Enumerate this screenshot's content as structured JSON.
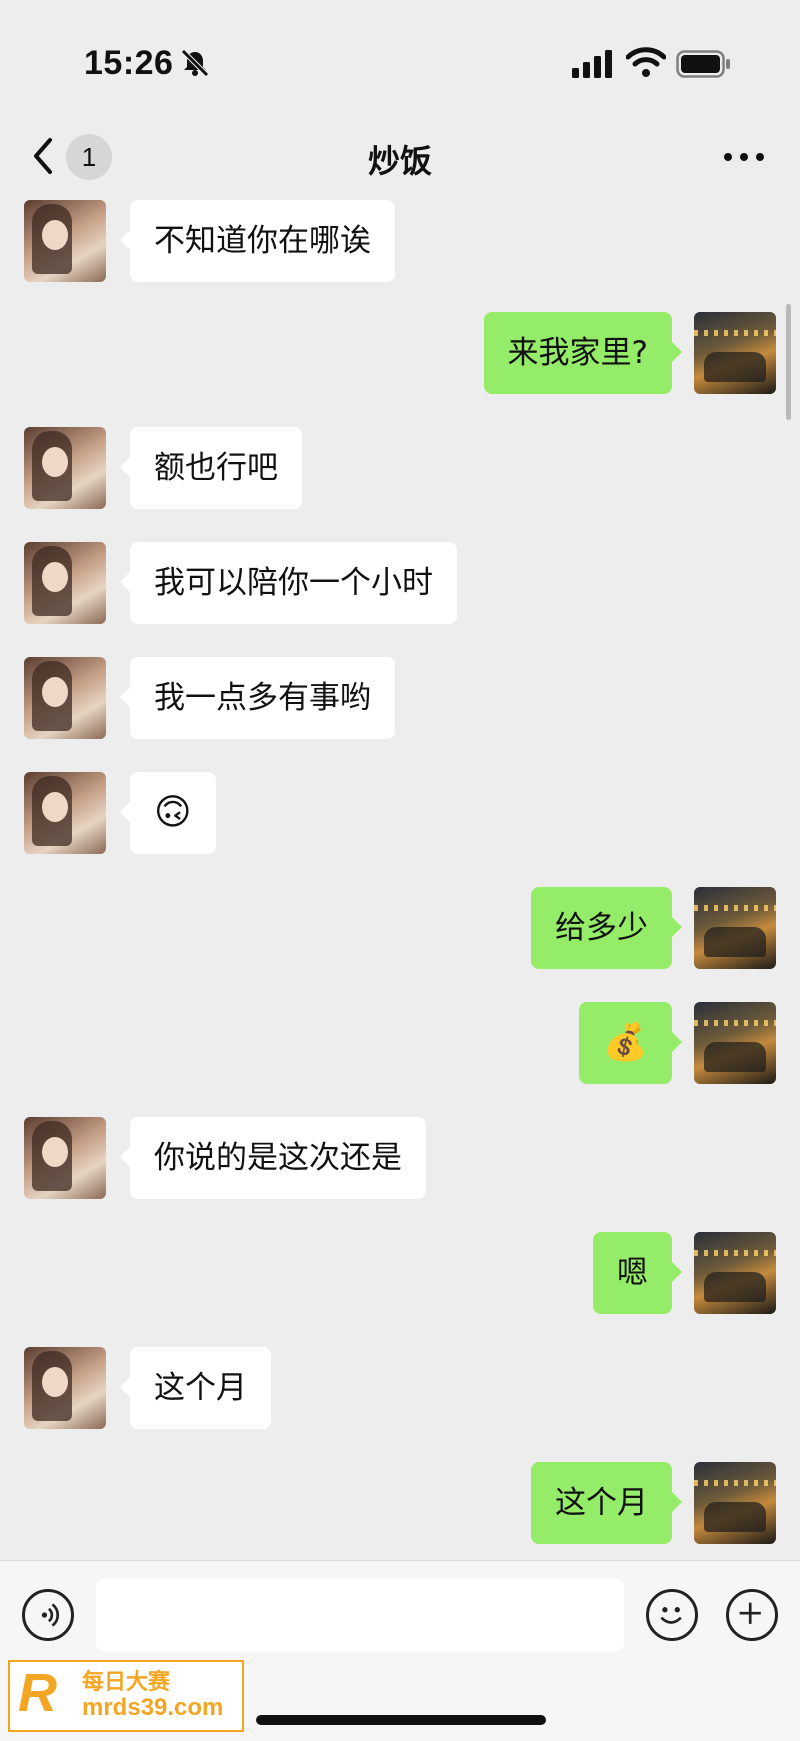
{
  "status_bar": {
    "time": "15:26"
  },
  "nav": {
    "unread_count": "1",
    "title": "炒饭"
  },
  "messages": [
    {
      "side": "left",
      "text": "不知道你在哪诶"
    },
    {
      "side": "right",
      "text": "来我家里?"
    },
    {
      "side": "left",
      "text": "额也行吧"
    },
    {
      "side": "left",
      "text": "我可以陪你一个小时"
    },
    {
      "side": "left",
      "text": "我一点多有事哟"
    },
    {
      "side": "left",
      "text": "🙃",
      "emoji": true
    },
    {
      "side": "right",
      "text": "给多少"
    },
    {
      "side": "right",
      "text": "💰",
      "emoji": true
    },
    {
      "side": "left",
      "text": "你说的是这次还是"
    },
    {
      "side": "right",
      "text": "嗯"
    },
    {
      "side": "left",
      "text": "这个月"
    },
    {
      "side": "right",
      "text": "这个月"
    }
  ],
  "input": {
    "value": ""
  },
  "watermark": {
    "logo_letter": "R",
    "name": "每日大赛",
    "url": "mrds39.com"
  },
  "colors": {
    "bubble_self": "#95ec69",
    "bubble_other": "#ffffff",
    "background": "#ededed",
    "watermark": "#f3a623"
  }
}
